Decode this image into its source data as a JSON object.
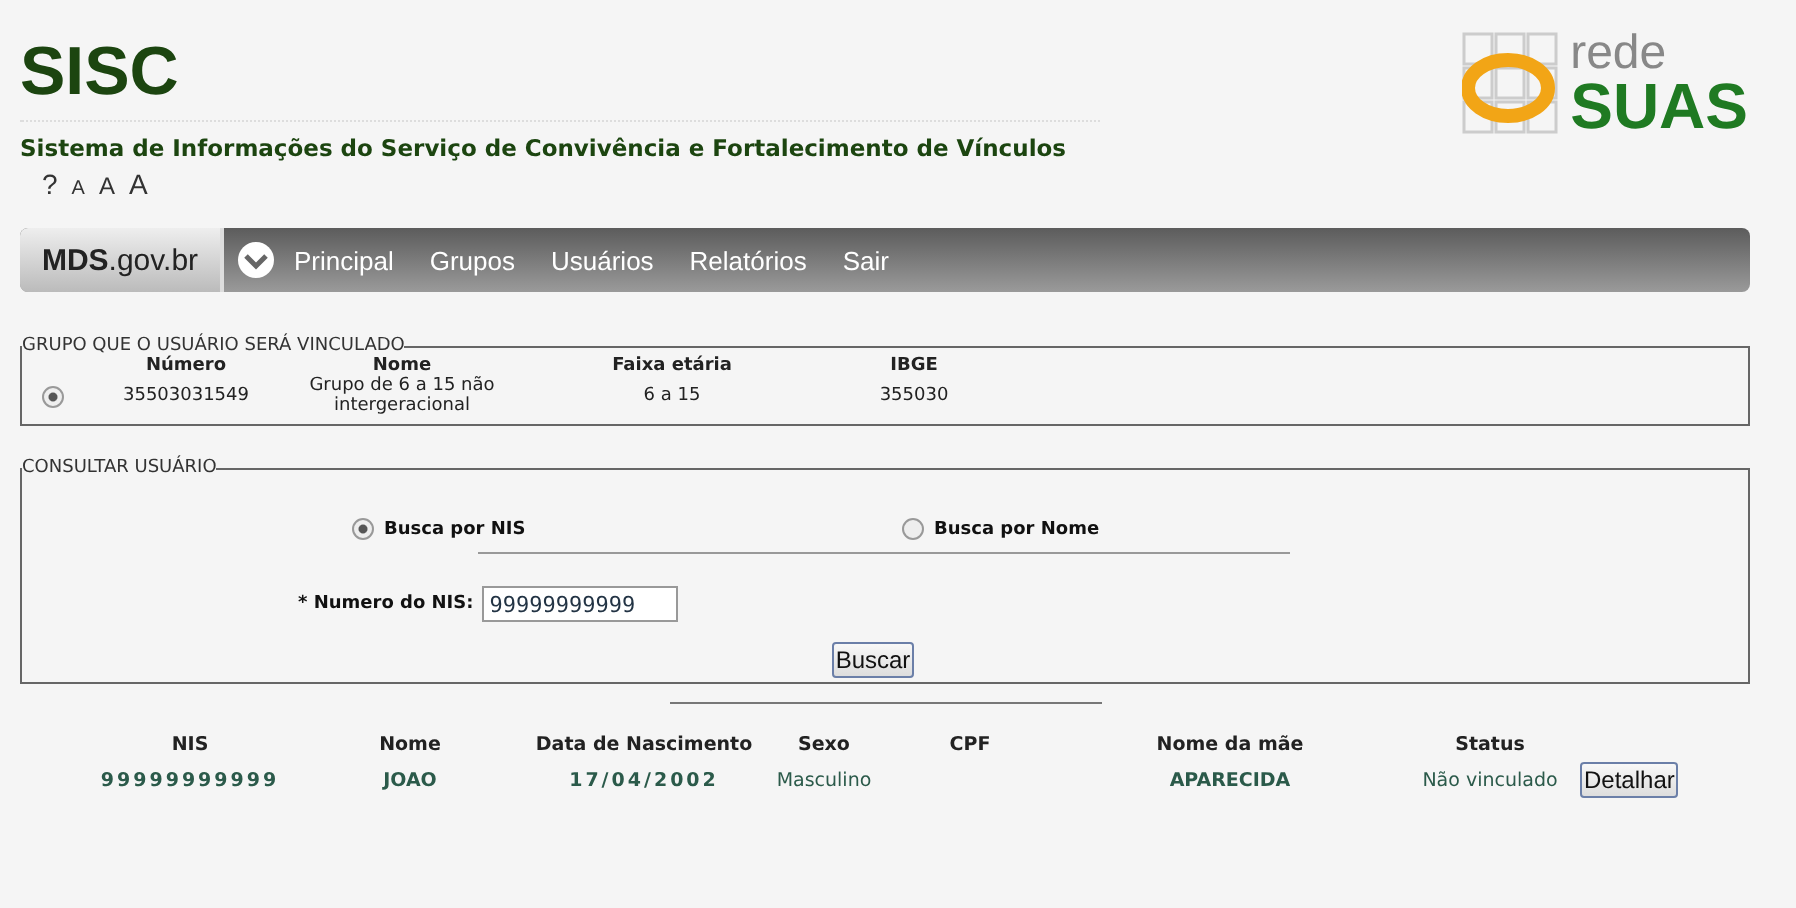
{
  "header": {
    "title": "SISC",
    "subtitle": "Sistema de Informações do Serviço de Convivência e Fortalecimento de Vínculos",
    "tools": [
      "?",
      "A",
      "A",
      "A"
    ]
  },
  "logo": {
    "small": "rede",
    "big": "SUAS"
  },
  "nav": {
    "brand_bold": "MDS",
    "brand_rest": ".gov.br",
    "items": [
      "Principal",
      "Grupos",
      "Usuários",
      "Relatórios",
      "Sair"
    ]
  },
  "group": {
    "legend": "GRUPO QUE O USUÁRIO SERÁ VINCULADO",
    "columns": [
      "Número",
      "Nome",
      "Faixa etária",
      "IBGE"
    ],
    "rows": [
      {
        "selected": true,
        "cells": [
          "35503031549",
          "Grupo de 6 a 15 não intergeracional",
          "6 a 15",
          "355030"
        ]
      }
    ]
  },
  "search": {
    "legend": "CONSULTAR USUÁRIO",
    "options": [
      {
        "label": "Busca por NIS",
        "selected": true
      },
      {
        "label": "Busca por Nome",
        "selected": false
      }
    ],
    "field_label": "* Numero do NIS:",
    "field_value": "99999999999",
    "button": "Buscar"
  },
  "results": {
    "columns": [
      "NIS",
      "Nome",
      "Data de Nascimento",
      "Sexo",
      "CPF",
      "Nome da mãe",
      "Status"
    ],
    "rows": [
      {
        "cells": [
          "99999999999",
          "JOAO",
          "17/04/2002",
          "Masculino",
          "",
          "APARECIDA",
          "Não vinculado"
        ],
        "button": "Detalhar"
      }
    ]
  }
}
